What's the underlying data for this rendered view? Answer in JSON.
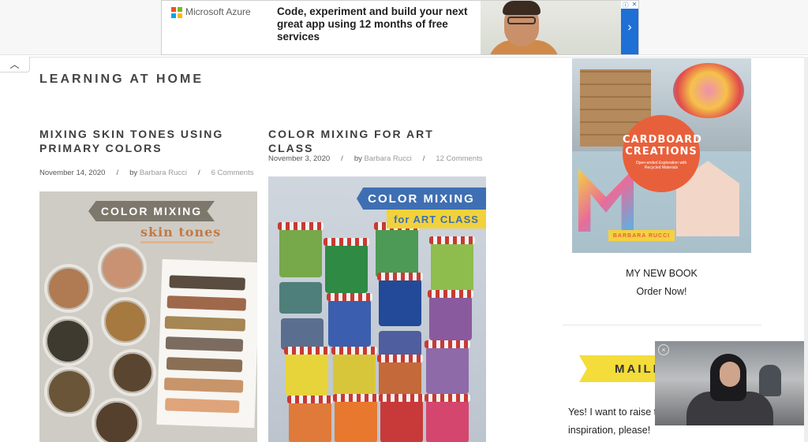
{
  "ad": {
    "brand": "Microsoft Azure",
    "headline": "Code, experiment and build your next great app using 12 months of free services",
    "arrow": "›",
    "info_icon": "ⓘ",
    "close_icon": "✕"
  },
  "nav": {
    "collapse_icon": "︿"
  },
  "section": {
    "title": "LEARNING AT HOME"
  },
  "posts": [
    {
      "title": "MIXING SKIN TONES USING PRIMARY COLORS",
      "date": "November 14, 2020",
      "by": "by",
      "author": "Barbara Rucci",
      "comments": "6 Comments",
      "image_banner": "COLOR MIXING",
      "image_subtitle": "skin tones"
    },
    {
      "title": "COLOR MIXING FOR ART CLASS",
      "date": "November 3, 2020",
      "by": "by",
      "author": "Barbara Rucci",
      "comments": "12 Comments",
      "image_banner": "COLOR MIXING",
      "image_subtitle": "for ART CLASS"
    }
  ],
  "meta_separator": "/",
  "sidebar": {
    "book_title": "CARDBOARD CREATIONS",
    "book_subtitle": "Open-ended Exploration with Recycled Materials",
    "book_author": "BARBARA RUCCI",
    "book_label": "MY NEW BOOK",
    "book_cta": "Order Now!",
    "mailing_heading": "MAILI",
    "mailing_body": "Yes! I want to raise t children. Send me more inspiration, please!"
  },
  "video": {
    "close_icon": "×"
  }
}
